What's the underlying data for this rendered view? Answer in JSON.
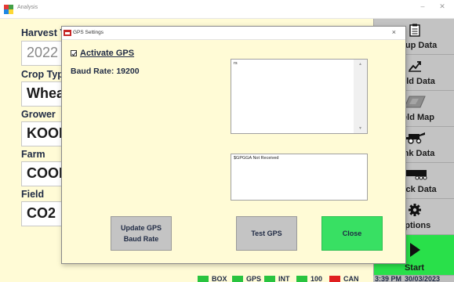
{
  "window": {
    "title": "Analysis",
    "minimize_glyph": "–",
    "close_glyph": "✕"
  },
  "form": {
    "harvest_year": {
      "label": "Harvest Year",
      "value": "2022"
    },
    "crop_type": {
      "label": "Crop Type",
      "value": "Wheat"
    },
    "grower": {
      "label": "Grower",
      "value": "KOOL"
    },
    "farm": {
      "label": "Farm",
      "value": "COOL"
    },
    "field": {
      "label": "Field",
      "value": "CO2"
    }
  },
  "sidebar": {
    "items": [
      {
        "label": "Setup Data",
        "icon": "clipboard-icon"
      },
      {
        "label": "Yield Data",
        "icon": "chart-icon"
      },
      {
        "label": "Yield Map",
        "icon": "map-icon"
      },
      {
        "label": "Tank Data",
        "icon": "harvester-icon"
      },
      {
        "label": "Truck Data",
        "icon": "truck-icon"
      },
      {
        "label": "Options",
        "icon": "gear-icon"
      },
      {
        "label": "Start",
        "icon": "play-icon"
      }
    ]
  },
  "dialog": {
    "title": "GPS Settings",
    "close_glyph": "×",
    "activate_label": "Activate GPS",
    "activate_checked": true,
    "baud_rate": "Baud Rate: 19200",
    "log_text": "rs",
    "status_text": "$GPGGA Not Received",
    "buttons": {
      "update": "Update GPS Baud Rate",
      "test": "Test GPS",
      "close": "Close"
    }
  },
  "statusbar": {
    "items": [
      {
        "label": "BOX",
        "color": "#29c43f"
      },
      {
        "label": "GPS",
        "color": "#29c43f"
      },
      {
        "label": "INT",
        "color": "#29c43f"
      },
      {
        "label": "100",
        "color": "#29c43f"
      },
      {
        "label": "CAN",
        "color": "#e02020"
      }
    ],
    "time": "3:39 PM",
    "date": "30/03/2023"
  },
  "colors": {
    "accent_green": "#29e04a",
    "background": "#fffbd6",
    "status_red": "#e02020"
  }
}
